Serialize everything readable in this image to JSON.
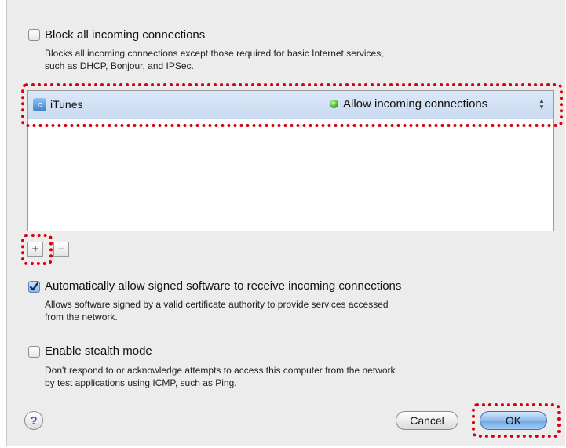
{
  "block_all": {
    "label": "Block all incoming connections",
    "checked": false,
    "description_line1": "Blocks all incoming connections except those required for basic Internet services,",
    "description_line2": "such as DHCP, Bonjour, and IPSec."
  },
  "app_list": {
    "rows": [
      {
        "app_name": "iTunes",
        "icon": "itunes-icon",
        "status_icon": "green-dot-icon",
        "status_color": "#3fb023",
        "status_text": "Allow incoming connections"
      }
    ]
  },
  "list_buttons": {
    "add_label": "+",
    "remove_label": "−"
  },
  "auto_allow": {
    "label": "Automatically allow signed software to receive incoming connections",
    "checked": true,
    "description_line1": "Allows software signed by a valid certificate authority to provide services accessed",
    "description_line2": "from the network."
  },
  "stealth": {
    "label": "Enable stealth mode",
    "checked": false,
    "description_line1": "Don't respond to or acknowledge attempts to access this computer from the network",
    "description_line2": "by test applications using ICMP, such as Ping."
  },
  "footer": {
    "help_label": "?",
    "cancel_label": "Cancel",
    "ok_label": "OK"
  },
  "highlight_color": "#d7000f"
}
